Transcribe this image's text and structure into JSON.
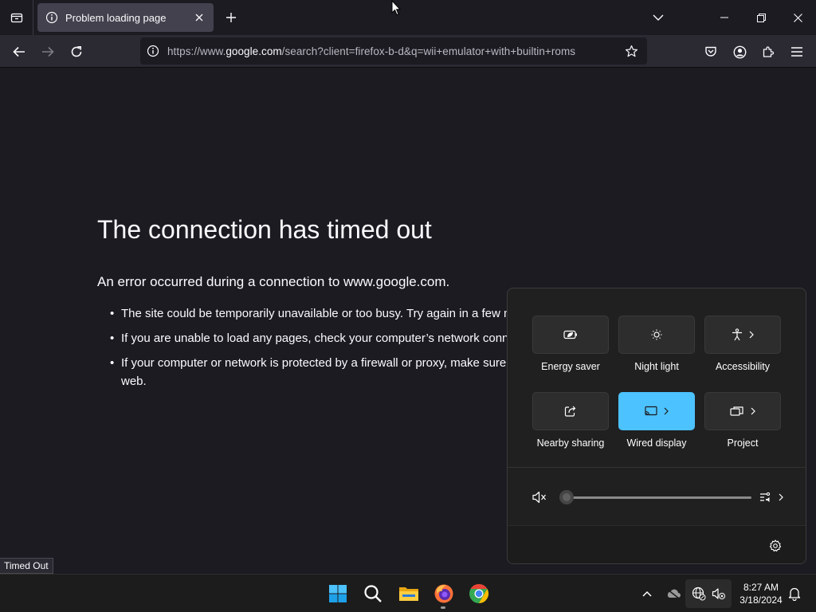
{
  "browser": {
    "tab": {
      "title": "Problem loading page"
    },
    "url": {
      "prefix": "https://www.",
      "host": "google.com",
      "rest": "/search?client=firefox-b-d&q=wii+emulator+with+builtin+roms"
    }
  },
  "page": {
    "title": "The connection has timed out",
    "description": "An error occurred during a connection to www.google.com.",
    "bullets": [
      "The site could be temporarily unavailable or too busy. Try again in a few m",
      "If you are unable to load any pages, check your computer’s network conne",
      "If your computer or network is protected by a firewall or proxy, make sure web."
    ],
    "status": "Timed Out"
  },
  "quick_settings": {
    "tiles": [
      {
        "label": "Energy saver",
        "icon": "energy-saver-icon",
        "active": false,
        "chevron": false
      },
      {
        "label": "Night light",
        "icon": "night-light-icon",
        "active": false,
        "chevron": false
      },
      {
        "label": "Accessibility",
        "icon": "accessibility-icon",
        "active": false,
        "chevron": true
      },
      {
        "label": "Nearby sharing",
        "icon": "nearby-sharing-icon",
        "active": false,
        "chevron": false
      },
      {
        "label": "Wired display",
        "icon": "cast-icon",
        "active": true,
        "chevron": true
      },
      {
        "label": "Project",
        "icon": "project-icon",
        "active": false,
        "chevron": true
      }
    ],
    "volume": {
      "level": 0,
      "muted": true
    },
    "accent_color": "#4cc2ff"
  },
  "taskbar": {
    "time": "8:27 AM",
    "date": "3/18/2024",
    "apps": [
      "start-icon",
      "search-icon",
      "file-explorer-icon",
      "firefox-icon",
      "chrome-icon"
    ]
  }
}
